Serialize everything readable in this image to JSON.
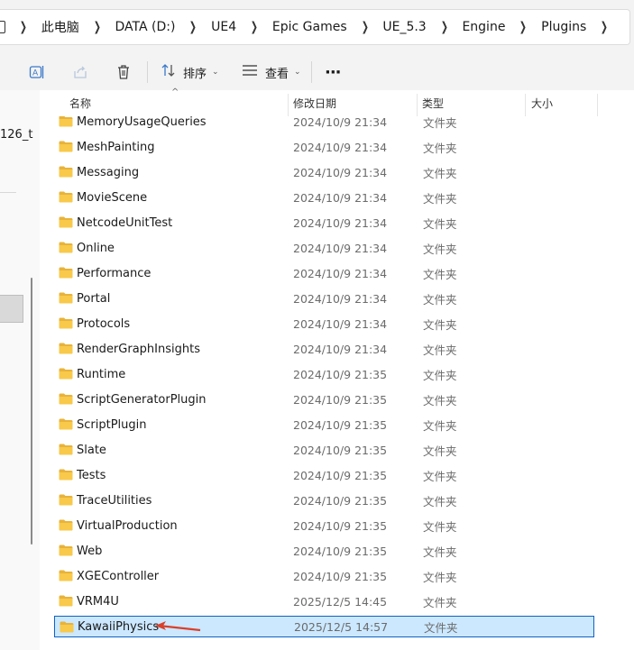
{
  "breadcrumb": [
    {
      "label": "此电脑"
    },
    {
      "label": "DATA (D:)"
    },
    {
      "label": "UE4"
    },
    {
      "label": "Epic Games"
    },
    {
      "label": "UE_5.3"
    },
    {
      "label": "Engine"
    },
    {
      "label": "Plugins"
    }
  ],
  "toolbar": {
    "sort_label": "排序",
    "view_label": "查看",
    "more_label": "···",
    "icons": [
      "rename-icon",
      "share-icon",
      "delete-icon",
      "sort-icon",
      "view-icon",
      "more-icon"
    ]
  },
  "nav": {
    "fragment_text": "126_t"
  },
  "columns": {
    "name": "名称",
    "date": "修改日期",
    "type": "类型",
    "size": "大小"
  },
  "files": [
    {
      "name": "MemoryUsageQueries",
      "date": "2024/10/9 21:34",
      "type": "文件夹"
    },
    {
      "name": "MeshPainting",
      "date": "2024/10/9 21:34",
      "type": "文件夹"
    },
    {
      "name": "Messaging",
      "date": "2024/10/9 21:34",
      "type": "文件夹"
    },
    {
      "name": "MovieScene",
      "date": "2024/10/9 21:34",
      "type": "文件夹"
    },
    {
      "name": "NetcodeUnitTest",
      "date": "2024/10/9 21:34",
      "type": "文件夹"
    },
    {
      "name": "Online",
      "date": "2024/10/9 21:34",
      "type": "文件夹"
    },
    {
      "name": "Performance",
      "date": "2024/10/9 21:34",
      "type": "文件夹"
    },
    {
      "name": "Portal",
      "date": "2024/10/9 21:34",
      "type": "文件夹"
    },
    {
      "name": "Protocols",
      "date": "2024/10/9 21:34",
      "type": "文件夹"
    },
    {
      "name": "RenderGraphInsights",
      "date": "2024/10/9 21:34",
      "type": "文件夹"
    },
    {
      "name": "Runtime",
      "date": "2024/10/9 21:35",
      "type": "文件夹"
    },
    {
      "name": "ScriptGeneratorPlugin",
      "date": "2024/10/9 21:35",
      "type": "文件夹"
    },
    {
      "name": "ScriptPlugin",
      "date": "2024/10/9 21:35",
      "type": "文件夹"
    },
    {
      "name": "Slate",
      "date": "2024/10/9 21:35",
      "type": "文件夹"
    },
    {
      "name": "Tests",
      "date": "2024/10/9 21:35",
      "type": "文件夹"
    },
    {
      "name": "TraceUtilities",
      "date": "2024/10/9 21:35",
      "type": "文件夹"
    },
    {
      "name": "VirtualProduction",
      "date": "2024/10/9 21:35",
      "type": "文件夹"
    },
    {
      "name": "Web",
      "date": "2024/10/9 21:35",
      "type": "文件夹"
    },
    {
      "name": "XGEController",
      "date": "2024/10/9 21:35",
      "type": "文件夹"
    },
    {
      "name": "VRM4U",
      "date": "2025/12/5 14:45",
      "type": "文件夹"
    },
    {
      "name": "KawaiiPhysics",
      "date": "2025/12/5 14:57",
      "type": "文件夹",
      "selected": true
    }
  ],
  "colors": {
    "selection_bg": "#cce8ff",
    "selection_border": "#0f62c4",
    "folder": "#f8c94a",
    "annotation_arrow": "#d9402a"
  }
}
